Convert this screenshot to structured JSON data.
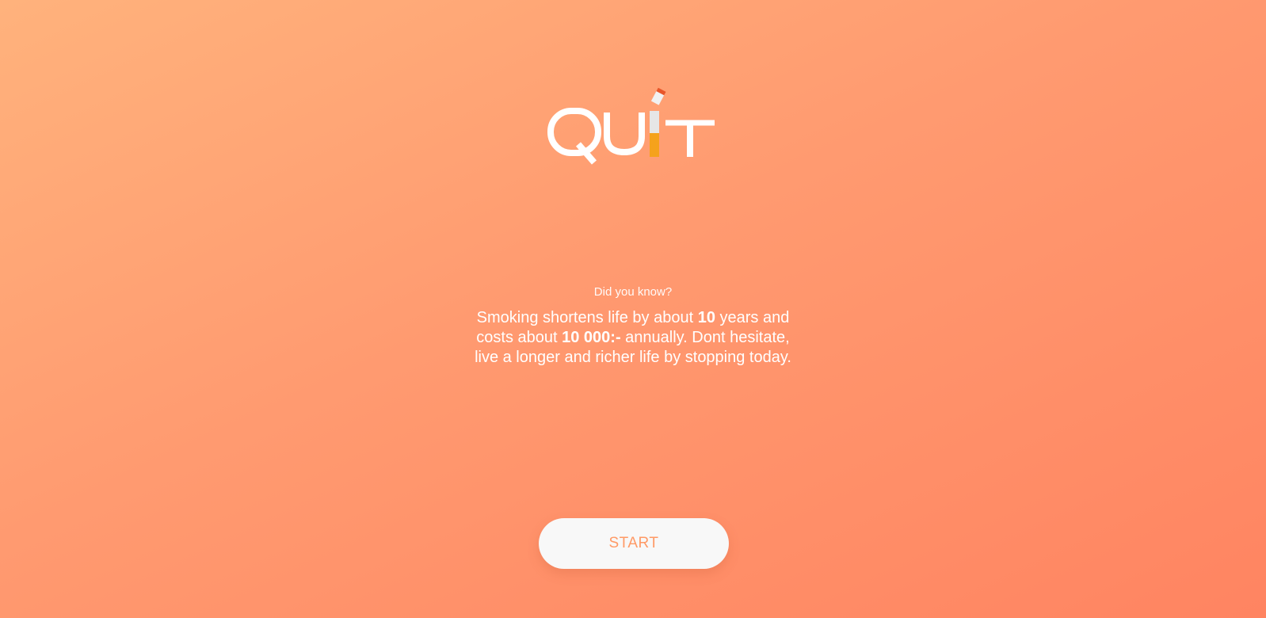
{
  "logo": {
    "text": "QUIT",
    "colors": {
      "letters": "#ffffff",
      "ember": "#e8562a",
      "ash": "#e6e6e6",
      "filter": "#f5a21c"
    }
  },
  "fact": {
    "heading": "Did you know?",
    "part1": "Smoking shortens life by about ",
    "bold1": "10",
    "part2": " years and costs about ",
    "bold2": "10 000:-",
    "part3": " annually. Dont hesitate, live a longer and richer life by stopping today."
  },
  "start_button": {
    "label": "START"
  },
  "colors": {
    "background_start": "#ffb27c",
    "background_end": "#ff8461",
    "button_bg": "#f8f8f8",
    "button_text": "#ff9a66"
  }
}
